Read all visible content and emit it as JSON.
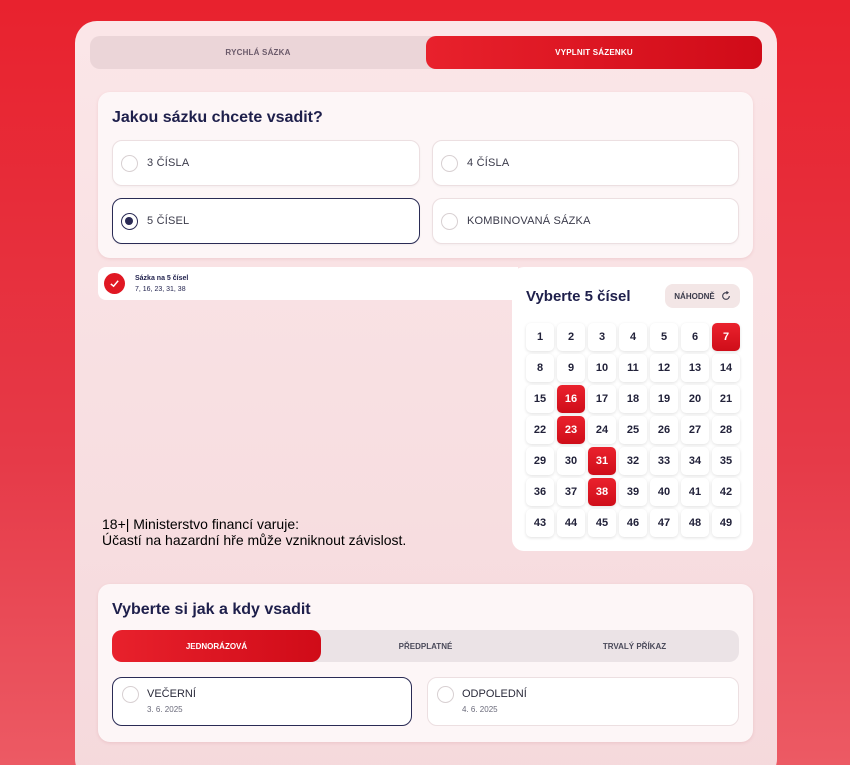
{
  "top_tabs": {
    "quick_bet": "RYCHLÁ SÁZKA",
    "fill_ticket": "VYPLNIT SÁZENKU"
  },
  "bet_type": {
    "title": "Jakou sázku chcete vsadit?",
    "options": [
      {
        "label": "3 ČÍSLA",
        "selected": false
      },
      {
        "label": "4 ČÍSLA",
        "selected": false
      },
      {
        "label": "5 ČÍSEL",
        "selected": true
      },
      {
        "label": "KOMBINOVANÁ SÁZKA",
        "selected": false
      }
    ]
  },
  "summary": {
    "title": "Sázka na 5 čísel",
    "numbers": "7, 16, 23, 31, 38"
  },
  "warning": {
    "line1": "18+| Ministerstvo financí varuje:",
    "line2": "Účastí na hazardní hře může vzniknout závislost."
  },
  "picker": {
    "title": "Vyberte 5 čísel",
    "random_label": "NÁHODNĚ",
    "random_icon": "refresh-icon",
    "numbers": [
      1,
      2,
      3,
      4,
      5,
      6,
      7,
      8,
      9,
      10,
      11,
      12,
      13,
      14,
      15,
      16,
      17,
      18,
      19,
      20,
      21,
      22,
      23,
      24,
      25,
      26,
      27,
      28,
      29,
      30,
      31,
      32,
      33,
      34,
      35,
      36,
      37,
      38,
      39,
      40,
      41,
      42,
      43,
      44,
      45,
      46,
      47,
      48,
      49
    ],
    "selected": [
      7,
      16,
      23,
      31,
      38
    ]
  },
  "schedule": {
    "title": "Vyberte si jak a kdy vsadit",
    "tabs": [
      "JEDNORÁZOVÁ",
      "PŘEDPLATNÉ",
      "TRVALÝ PŘÍKAZ"
    ],
    "draws": [
      {
        "name": "VEČERNÍ",
        "date": "3. 6. 2025",
        "selected": true
      },
      {
        "name": "ODPOLEDNÍ",
        "date": "4. 6. 2025",
        "selected": false
      }
    ]
  },
  "colors": {
    "accent": "#e01823",
    "navy": "#1e1f4b"
  }
}
